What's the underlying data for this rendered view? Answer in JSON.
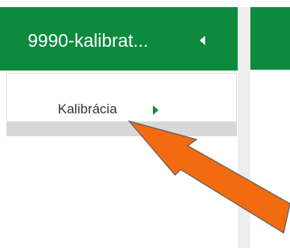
{
  "header": {
    "title": "9990-kalibrat...",
    "toggle_icon": "caret-left-icon"
  },
  "menu": {
    "items": [
      {
        "label": "Kalibrácia",
        "icon": "caret-right-icon"
      }
    ]
  },
  "colors": {
    "accent": "#0c8a3e",
    "annotation_arrow": "#f26b11"
  }
}
